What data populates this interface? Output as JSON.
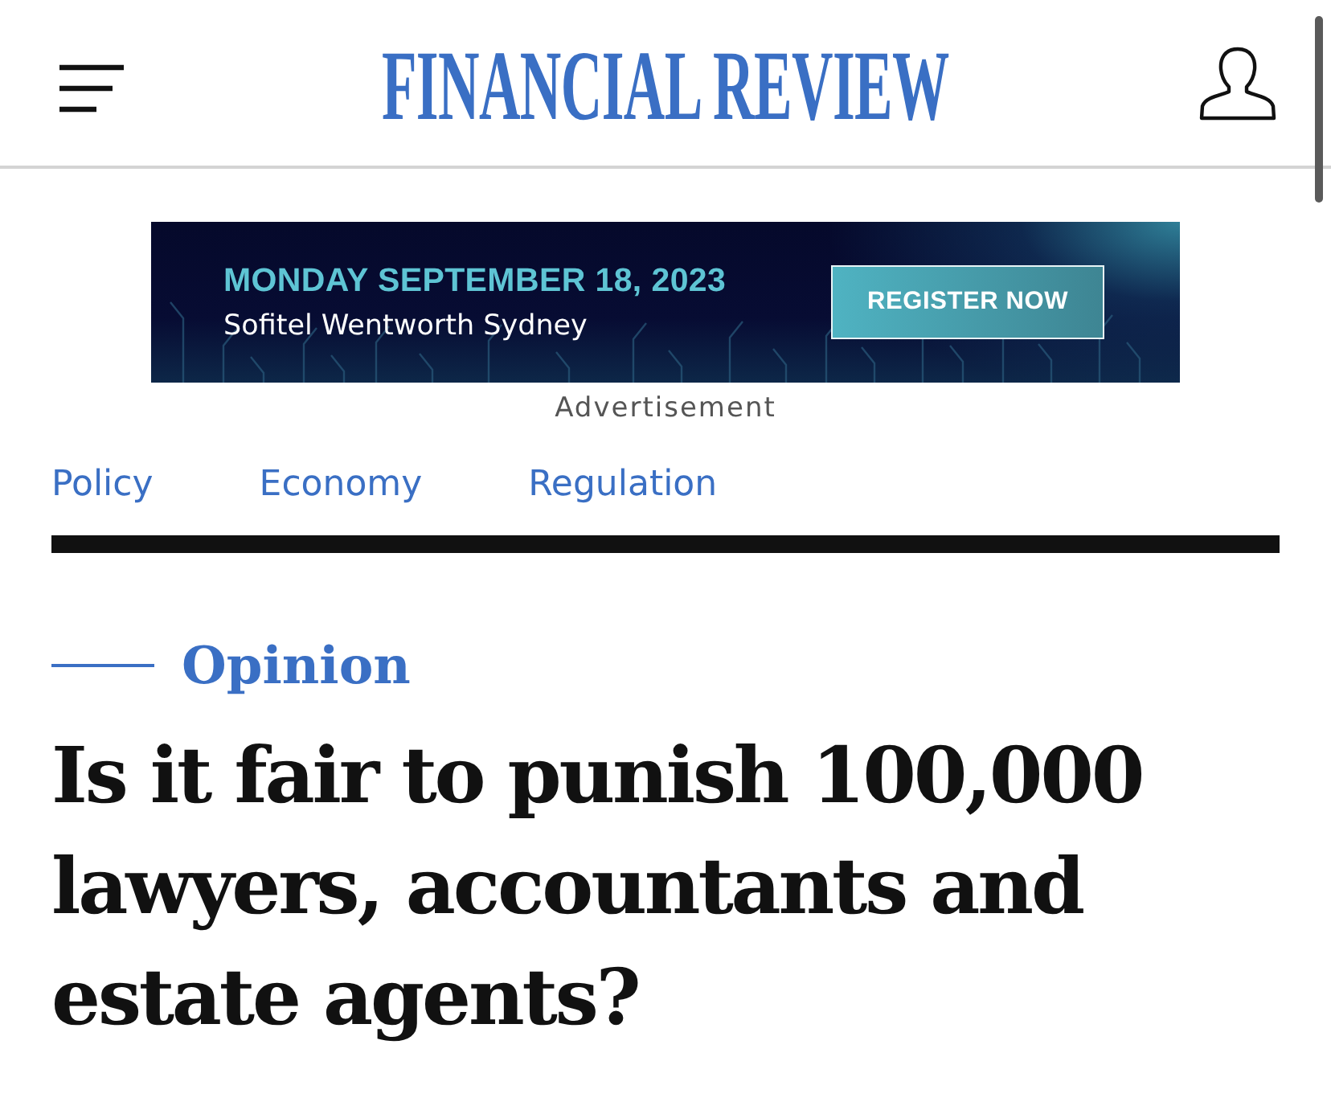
{
  "header": {
    "logo": "FINANCIAL REVIEW"
  },
  "advertisement": {
    "date": "MONDAY SEPTEMBER 18, 2023",
    "venue": "Sofitel Wentworth Sydney",
    "button": "REGISTER NOW",
    "label": "Advertisement"
  },
  "section_links": [
    "Policy",
    "Economy",
    "Regulation"
  ],
  "article": {
    "category": "Opinion",
    "headline": "Is it fair to punish 100,000 lawyers, accountants and estate agents?"
  }
}
